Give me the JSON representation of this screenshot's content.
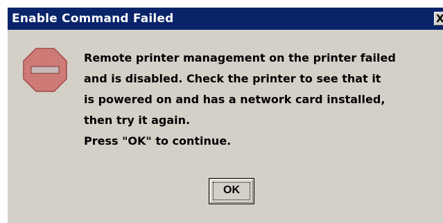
{
  "window": {
    "title": "Enable Command Failed",
    "close_glyph": "X",
    "close_icon": "close-icon"
  },
  "icon": {
    "name": "stop-icon",
    "color": "#c0504d"
  },
  "message": {
    "lines": [
      "Remote printer management on the printer failed",
      "and is disabled. Check the printer to see that it",
      "is powered on and has a network card installed,",
      "then try it again.",
      "Press \"OK\" to continue."
    ]
  },
  "buttons": {
    "ok_label": "OK"
  },
  "colors": {
    "titlebar": "#0a246a",
    "dialog_bg": "#d4d0c8"
  }
}
